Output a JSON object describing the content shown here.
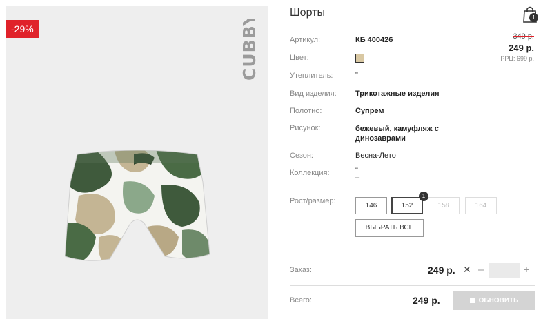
{
  "product": {
    "title": "Шорты",
    "discount_badge": "-29%",
    "brand": "CUBBY",
    "image_icon": "camo-shorts-image"
  },
  "header": {
    "cart_icon": "shopping-bag-icon",
    "cart_count": "1"
  },
  "pricing": {
    "old_price": "349 р.",
    "price": "249 р.",
    "rrp": "РРЦ: 699 р."
  },
  "attributes": [
    {
      "label": "Артикул:",
      "value": "КБ 400426"
    },
    {
      "label": "Цвет:",
      "value": ""
    },
    {
      "label": "Утеплитель:",
      "value": "\""
    },
    {
      "label": "Вид изделия:",
      "value": "Трикотажные изделия"
    },
    {
      "label": "Полотно:",
      "value": "Супрем"
    },
    {
      "label": "Рисунок:",
      "value": "бежевый, камуфляж с динозаврами"
    },
    {
      "label": "Сезон:",
      "value": "Весна-Лето"
    },
    {
      "label": "Коллекция:",
      "value": "\"\n–"
    }
  ],
  "color_swatch": "#d9c8a3",
  "sizes": {
    "label": "Рост/размер:",
    "options": [
      {
        "value": "146",
        "state": "available"
      },
      {
        "value": "152",
        "state": "selected",
        "badge": "1"
      },
      {
        "value": "158",
        "state": "disabled"
      },
      {
        "value": "164",
        "state": "disabled"
      }
    ],
    "select_all_label": "ВЫБРАТЬ ВСЕ"
  },
  "order": {
    "label": "Заказ:",
    "price": "249 р.",
    "times": "✕",
    "minus": "–",
    "plus": "+",
    "quantity": ""
  },
  "total": {
    "label": "Всего:",
    "price": "249 р.",
    "update_label": "ОБНОВИТЬ"
  },
  "colors": {
    "discount": "#e0222a",
    "button_disabled": "#d4d4d4"
  }
}
